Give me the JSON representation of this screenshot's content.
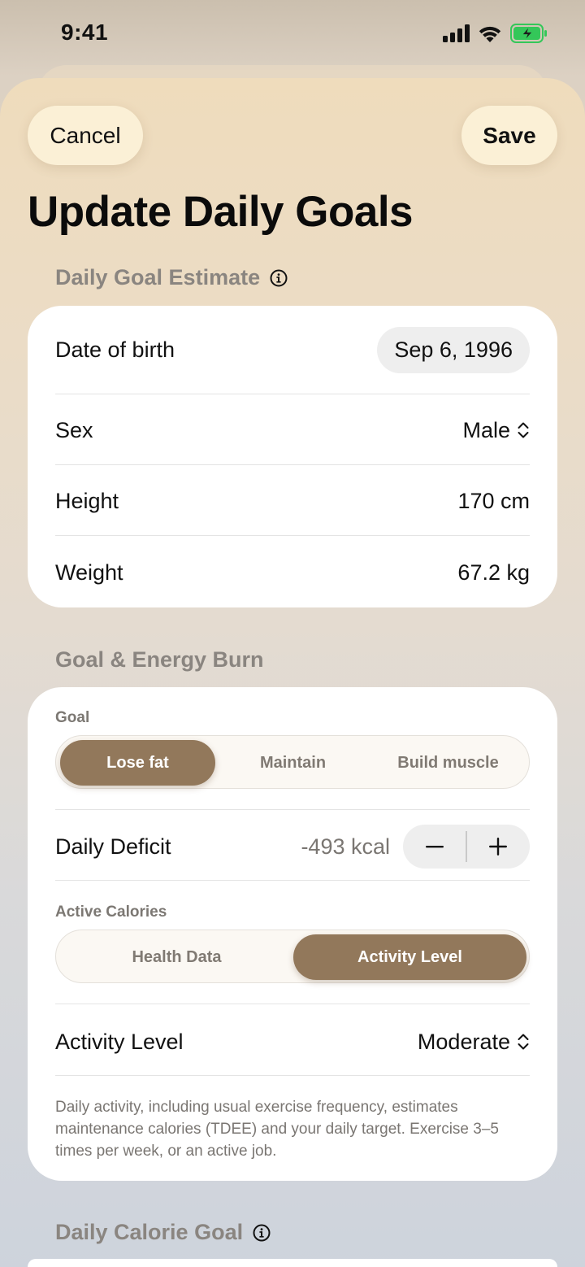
{
  "status_bar": {
    "time": "9:41"
  },
  "header": {
    "cancel_label": "Cancel",
    "save_label": "Save",
    "title": "Update Daily Goals"
  },
  "estimate_section": {
    "header": "Daily Goal Estimate",
    "rows": {
      "dob": {
        "label": "Date of birth",
        "value": "Sep 6, 1996"
      },
      "sex": {
        "label": "Sex",
        "value": "Male"
      },
      "height": {
        "label": "Height",
        "value": "170 cm"
      },
      "weight": {
        "label": "Weight",
        "value": "67.2 kg"
      }
    }
  },
  "energy_section": {
    "header": "Goal & Energy Burn",
    "goal_label": "Goal",
    "goal_options": [
      "Lose fat",
      "Maintain",
      "Build muscle"
    ],
    "goal_selected": "Lose fat",
    "deficit": {
      "label": "Daily Deficit",
      "value": "-493 kcal",
      "minus": "−",
      "plus": "+"
    },
    "active_label": "Active Calories",
    "active_options": [
      "Health Data",
      "Activity Level"
    ],
    "active_selected": "Activity Level",
    "activity": {
      "label": "Activity Level",
      "value": "Moderate"
    },
    "description": "Daily activity, including usual exercise frequency, estimates maintenance calories (TDEE) and your daily target. Exercise 3–5 times per week, or an active job."
  },
  "calorie_section": {
    "header": "Daily Calorie Goal"
  },
  "colors": {
    "accent": "#92785b",
    "button_bg": "#fbf0d6",
    "battery": "#34c759"
  },
  "icons": {
    "info": "info-icon",
    "chevron": "chevron-up-down-icon",
    "signal": "signal-icon",
    "wifi": "wifi-icon",
    "battery": "battery-charging-icon"
  }
}
